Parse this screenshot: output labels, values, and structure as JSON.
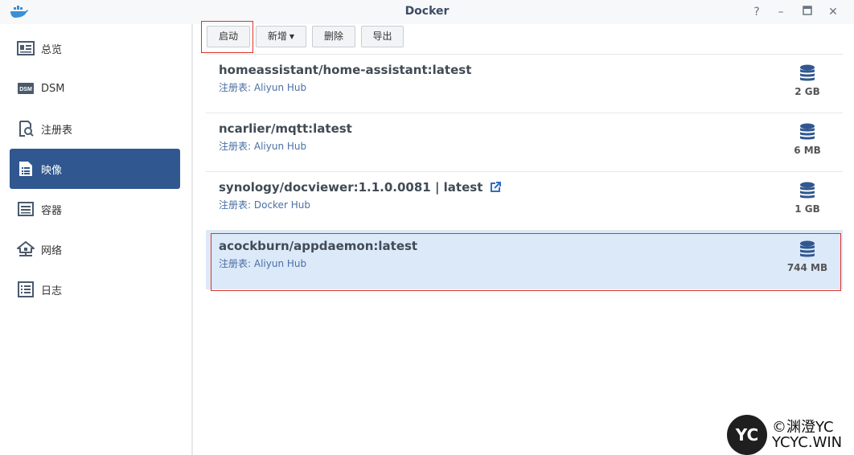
{
  "window": {
    "title": "Docker",
    "controls": [
      "help-icon",
      "minimize-icon",
      "maximize-icon",
      "close-icon"
    ],
    "help_glyph": "?",
    "minimize_glyph": "–",
    "close_glyph": "✕"
  },
  "sidebar": {
    "active_color": "#30578f",
    "items": [
      {
        "label": "总览",
        "icon": "overview-icon"
      },
      {
        "label": "DSM",
        "icon": "dsm-icon"
      },
      {
        "label": "注册表",
        "icon": "registry-icon"
      },
      {
        "label": "映像",
        "icon": "image-icon",
        "active": true
      },
      {
        "label": "容器",
        "icon": "container-icon"
      },
      {
        "label": "网络",
        "icon": "network-icon"
      },
      {
        "label": "日志",
        "icon": "log-icon"
      }
    ]
  },
  "toolbar": {
    "launch_label": "启动",
    "add_label": "新增",
    "delete_label": "删除",
    "export_label": "导出"
  },
  "images": [
    {
      "name": "homeassistant/home-assistant:latest",
      "registry": "注册表: Aliyun Hub",
      "size": "2 GB"
    },
    {
      "name": "ncarlier/mqtt:latest",
      "registry": "注册表: Aliyun Hub",
      "size": "6 MB"
    },
    {
      "name": "synology/docviewer:1.1.0.0081 | latest",
      "registry": "注册表: Docker Hub",
      "size": "1 GB",
      "has_external_link": true
    },
    {
      "name": "acockburn/appdaemon:latest",
      "registry": "注册表: Aliyun Hub",
      "size": "744 MB",
      "selected": true
    }
  ],
  "watermark": {
    "logo_text": "YC",
    "line1": "©渊澄YC",
    "line2": "YCYC.WIN"
  },
  "colors": {
    "highlight": "#d9342b",
    "selected_row": "#dce9f9",
    "db_icon": "#30578f"
  }
}
